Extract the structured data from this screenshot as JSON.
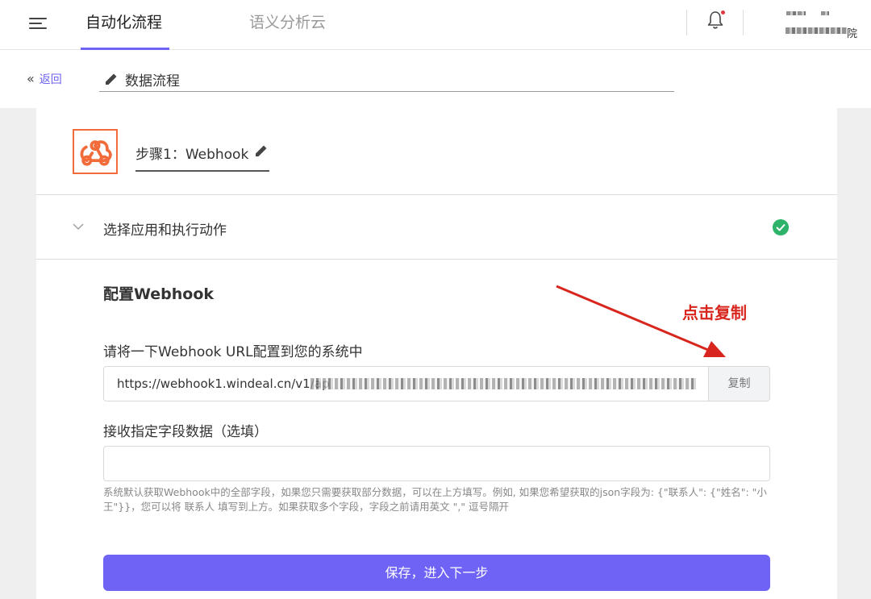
{
  "topbar": {
    "tabs": [
      {
        "label": "自动化流程",
        "active": true
      },
      {
        "label": "语义分析云",
        "active": false
      }
    ],
    "user_suffix": "院",
    "accent_color": "#6f63f5"
  },
  "subbar": {
    "back_label": "返回",
    "flow_title": "数据流程"
  },
  "step": {
    "label": "步骤1：Webhook",
    "icon": "webhook-icon",
    "icon_color": "#f26b3a"
  },
  "section": {
    "title": "选择应用和执行动作",
    "status": "complete",
    "status_color": "#2db36a"
  },
  "config": {
    "title": "配置Webhook",
    "url_label": "请将一下Webhook URL配置到您的系统中",
    "url_value": "https://webhook1.windeal.cn/v1/ap",
    "copy_label": "复制",
    "fields_label": "接收指定字段数据（选填）",
    "fields_value": "",
    "help_text": "系统默认获取Webhook中的全部字段，如果您只需要获取部分数据，可以在上方填写。例如, 如果您希望获取的json字段为: {\"联系人\": {\"姓名\": \"小王\"}}，您可以将 联系人 填写到上方。如果获取多个字段，字段之前请用英文 \",\" 逗号隔开",
    "save_label": "保存，进入下一步"
  },
  "annotation": {
    "text": "点击复制",
    "color": "#d8261e"
  }
}
